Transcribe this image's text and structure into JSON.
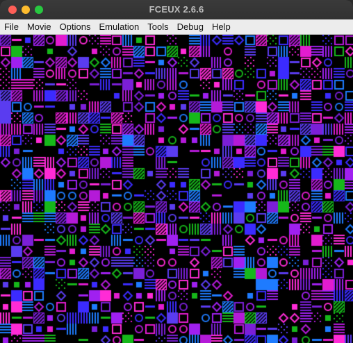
{
  "window": {
    "title": "FCEUX 2.6.6",
    "controls": {
      "close_color": "#fe5f57",
      "minimize_color": "#febc2e",
      "zoom_color": "#28c840"
    }
  },
  "menubar": {
    "items": [
      {
        "label": "File",
        "icon": "none"
      },
      {
        "label": "Movie",
        "icon": "none"
      },
      {
        "label": "Options",
        "icon": "none"
      },
      {
        "label": "Emulation",
        "icon": "none"
      },
      {
        "label": "Tools",
        "icon": "none"
      },
      {
        "label": "Debug",
        "icon": "none"
      },
      {
        "label": "Help",
        "icon": "none"
      }
    ]
  },
  "game_screen": {
    "content": "garbled tile pattern",
    "palette": [
      "#000000",
      "#7b1fd8",
      "#b41ad8",
      "#e21ccf",
      "#3b2bff",
      "#5a3cf0",
      "#1e7bff",
      "#16b81a",
      "#a020f0",
      "#ff2bd6"
    ]
  }
}
